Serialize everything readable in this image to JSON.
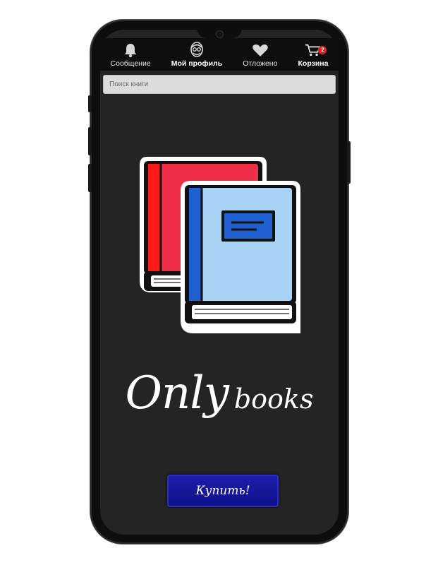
{
  "nav": {
    "items": [
      {
        "label": "Сообщение",
        "icon": "bell-icon",
        "bold": false
      },
      {
        "label": "Мой профиль",
        "icon": "user-avatar-icon",
        "bold": true
      },
      {
        "label": "Отложено",
        "icon": "heart-icon",
        "bold": false
      },
      {
        "label": "Корзина",
        "icon": "cart-icon",
        "bold": true
      }
    ],
    "cart_badge": "2"
  },
  "search": {
    "placeholder": "Поиск книги",
    "value": ""
  },
  "brand": {
    "word_big": "Only",
    "word_small": "books"
  },
  "buy_button": {
    "label": "Купить!"
  },
  "colors": {
    "screen_bg": "#242424",
    "button_blue": "#1d1ea8",
    "red_book": "#f0304a",
    "blue_book": "#a8d2f5",
    "badge_red": "#e02020"
  }
}
